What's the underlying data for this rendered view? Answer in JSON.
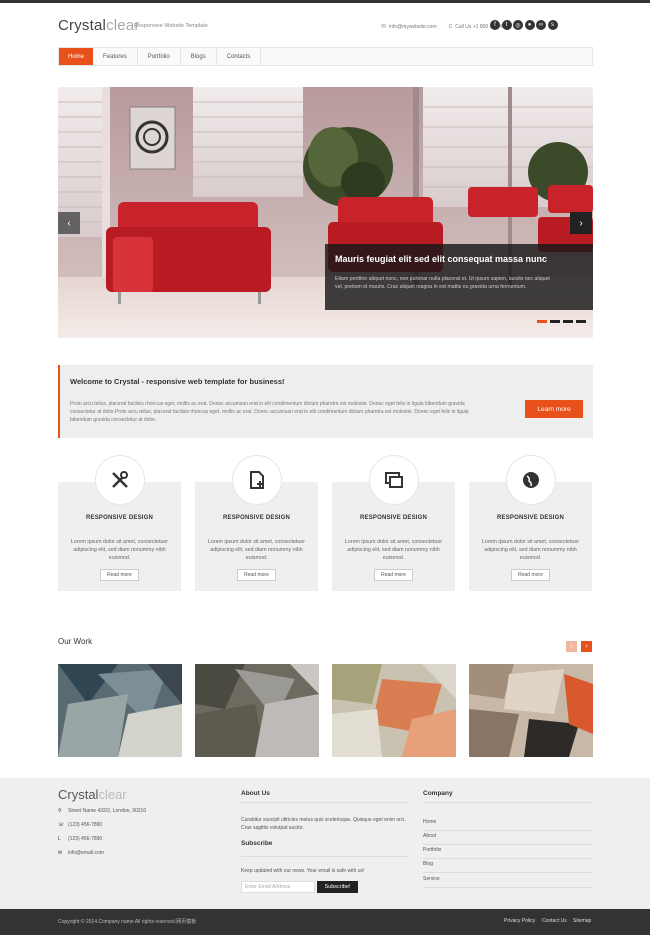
{
  "header": {
    "logo_primary": "Crystal",
    "logo_secondary": "clear",
    "tagline": "Responsive Website Template",
    "email": "info@mywebsite.com",
    "phone_prefix": "C",
    "phone": "Call Us +1 800 123 45 67",
    "social_icons": [
      "facebook-icon",
      "tumblr-icon",
      "dribbble-icon",
      "flickr-icon",
      "lastfm-icon",
      "skype-icon"
    ]
  },
  "nav": {
    "items": [
      {
        "label": "Home",
        "active": true
      },
      {
        "label": "Features",
        "active": false
      },
      {
        "label": "Portfolio",
        "active": false
      },
      {
        "label": "Blogs",
        "active": false
      },
      {
        "label": "Contacts",
        "active": false
      }
    ]
  },
  "slider": {
    "prev_label": "‹",
    "next_label": "›",
    "caption_title": "Mauris feugiat elit sed elit consequat massa nunc",
    "caption_line1": "Etiam porttitor aliquet nunc, non pulvinar nulla placerat et. Ut ipsum sapien, iaculis nec aliquet",
    "caption_line2": "vel, pretium id mauris. Cras aliquet magna in est mattis eu gravida urna fermentum.",
    "slide_count": 4,
    "active_slide": 1
  },
  "welcome": {
    "title": "Welcome to Crystal - responsive web template for business!",
    "text": "Proin arcu tellus, placerat facilisis rhoncus eget, mollis ac erat. Donec accumsan erat in elit condimentum dictum pharetra est molestie. Donec eget felis in ligula bibendum gravida consectetur at dolor.Proin arcu tellus, placerat facilisis rhoncus eget, mollis ac erat. Donec accumsan erat in elit condimentum dictum pharetra est molestie. Donec eget felis in ligula bibendum gravida consectetur at dolor.",
    "button": "Learn more"
  },
  "features": [
    {
      "icon": "tools-icon",
      "title": "RESPONSIVE DESIGN",
      "text": "Lorem ipsum dolor sit amet, consectetuer adipiscing elit, sed diam nonummy nibh euismod.",
      "button": "Read more"
    },
    {
      "icon": "document-add-icon",
      "title": "RESPONSIVE DESIGN",
      "text": "Lorem ipsum dolor sit amet, consectetuer adipiscing elit, sed diam nonummy nibh euismod.",
      "button": "Read more"
    },
    {
      "icon": "windows-icon",
      "title": "RESPONSIVE DESIGN",
      "text": "Lorem ipsum dolor sit amet, consectetuer adipiscing elit, sed diam nonummy nibh euismod.",
      "button": "Read more"
    },
    {
      "icon": "globe-icon",
      "title": "RESPONSIVE DESIGN",
      "text": "Lorem ipsum dolor sit amet, consectetuer adipiscing elit, sed diam nonummy nibh euismod.",
      "button": "Read more"
    }
  ],
  "work": {
    "title": "Our Work",
    "prev_label": "‹",
    "next_label": "›"
  },
  "footer": {
    "logo_primary": "Crystal",
    "logo_secondary": "clear",
    "address": "Street Name 432/2, London, 90210",
    "phone1": "(123) 456-7890",
    "phone2": "(123) 456-7890",
    "email": "info@email.com",
    "about_title": "About Us",
    "about_text": "Curabitur suscipit ultricies metus quis scelerisque. Quisque eget enim orci. Cras sagittis volutpat auctor.",
    "subscribe_title": "Subscribe",
    "subscribe_text": "Keep updated with our news. Your email is safe with us!",
    "email_placeholder": "Enter Email Address",
    "subscribe_button": "Subscribe!",
    "company_title": "Company",
    "company_links": [
      "Home",
      "About",
      "Portfolio",
      "Blog",
      "Service"
    ]
  },
  "bottom": {
    "copyright": "Copyright © 2014.Company name All rights reserved.网页模板",
    "links": [
      "Privacy Policy",
      "Contact Us",
      "Sitemap"
    ]
  },
  "colors": {
    "accent": "#e8511a",
    "dark": "#333333"
  }
}
